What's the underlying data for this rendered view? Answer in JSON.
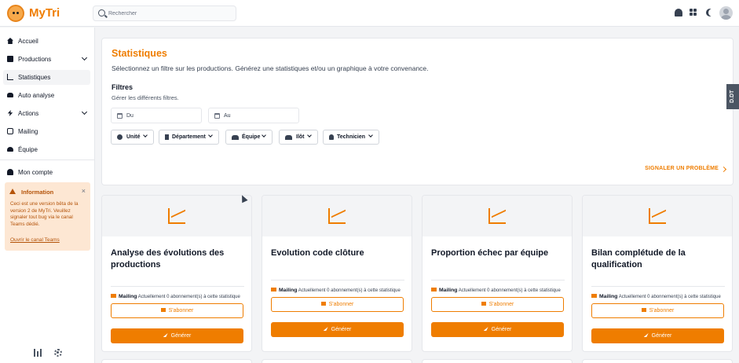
{
  "app": {
    "name": "MyTri",
    "brand_color": "#ef7d00"
  },
  "header": {
    "search_placeholder": "Rechercher",
    "icons": [
      "bell-icon",
      "grid-icon",
      "moon-icon",
      "avatar"
    ]
  },
  "sidebar": {
    "items": [
      {
        "label": "Accueil",
        "icon": "home-icon"
      },
      {
        "label": "Productions",
        "icon": "box-icon",
        "expandable": true
      },
      {
        "label": "Statistiques",
        "icon": "chart-icon",
        "active": true
      },
      {
        "label": "Auto analyse",
        "icon": "car-icon"
      },
      {
        "label": "Actions",
        "icon": "bolt-icon",
        "expandable": true
      },
      {
        "label": "Mailing",
        "icon": "mail-icon"
      },
      {
        "label": "Équipe",
        "icon": "users-icon"
      }
    ],
    "account_label": "Mon compte",
    "info": {
      "title": "Information",
      "text": "Ceci est une version bêta de la version 2 de MyTri. Veuillez signaler tout bug via le canal Teams dédié.",
      "link": "Ouvrir le canal Teams"
    }
  },
  "stats": {
    "title": "Statistiques",
    "subtitle": "Sélectionnez un filtre sur les productions. Générez une statistiques et/ou un graphique à votre convenance.",
    "filters_title": "Filtres",
    "filters_subtitle": "Gérer les différents filtres.",
    "date_from": "Du",
    "date_to": "Au",
    "filters": [
      "Unité",
      "Département",
      "Équipe",
      "Ilôt",
      "Technicien"
    ],
    "report_label": "SIGNALER UN PROBLÈME"
  },
  "side_tag": "D.DT",
  "cards": [
    {
      "title": "Analyse des évolutions des productions",
      "mailing_label": "Mailing",
      "mailing_text": "Actuellement 0 abonnement(s) à cette statistique",
      "subscribe": "S'abonner",
      "generate": "Générer"
    },
    {
      "title": "Evolution code clôture",
      "mailing_label": "Mailing",
      "mailing_text": "Actuellement 0 abonnement(s) à cette statistique",
      "subscribe": "S'abonner",
      "generate": "Générer"
    },
    {
      "title": "Proportion échec par équipe",
      "mailing_label": "Mailing",
      "mailing_text": "Actuellement 0 abonnement(s) à cette statistique",
      "subscribe": "S'abonner",
      "generate": "Générer"
    },
    {
      "title": "Bilan complétude de la qualification",
      "mailing_label": "Mailing",
      "mailing_text": "Actuellement 0 abonnement(s) à cette statistique",
      "subscribe": "S'abonner",
      "generate": "Générer"
    }
  ]
}
